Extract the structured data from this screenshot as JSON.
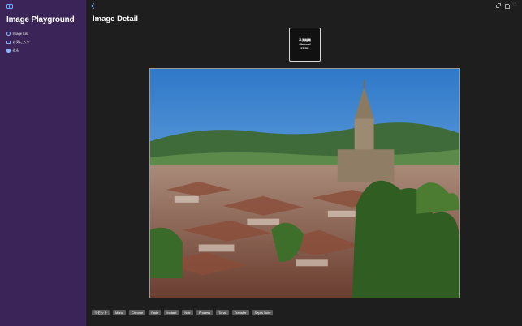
{
  "app": {
    "title": "Image Playground"
  },
  "sidebar": {
    "items": [
      {
        "label": "Image List",
        "icon": "photo-icon"
      },
      {
        "label": "お気に入り",
        "icon": "heart-icon"
      },
      {
        "label": "設定",
        "icon": "gear-icon"
      }
    ]
  },
  "detail": {
    "title": "Image Detail",
    "prediction": {
      "line1": "予測結果",
      "line2": "tile roof",
      "line3": "33.5%"
    }
  },
  "filters": [
    "リセット",
    "Mono",
    "Chrome",
    "Fade",
    "Instant",
    "Noir",
    "Process",
    "Tonal",
    "Transfer",
    "Sepia Tone"
  ],
  "colors": {
    "sidebar_bg": "#3b2558",
    "accent": "#6fa8ff",
    "main_bg": "#1e1e1e"
  }
}
